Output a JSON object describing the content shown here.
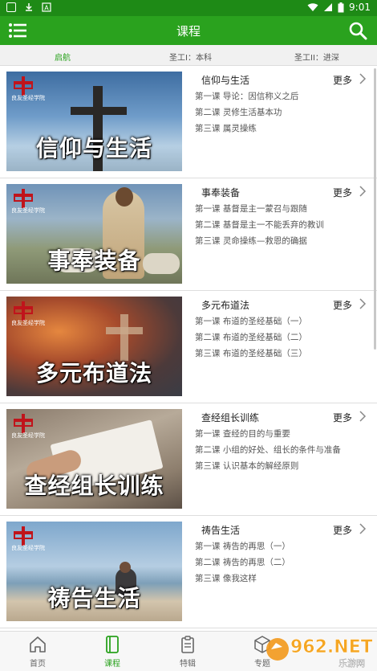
{
  "status": {
    "time": "9:01"
  },
  "appbar": {
    "title": "课程"
  },
  "tabs": [
    {
      "label": "启航"
    },
    {
      "label": "圣工I：本科"
    },
    {
      "label": "圣工II：进深"
    }
  ],
  "logo_text": "良友圣经学院",
  "more_label": "更多",
  "courses": [
    {
      "title": "信仰与生活",
      "image_title": "信仰与生活",
      "lessons": [
        "第一课 导论：因信称义之后",
        "第二课 灵修生活基本功",
        "第三课 属灵操练"
      ]
    },
    {
      "title": "事奉装备",
      "image_title": "事奉装备",
      "lessons": [
        "第一课 基督是主一蒙召与跟随",
        "第二课 基督是主一不能丢弃的教训",
        "第三课 灵命操练—救恩的确据"
      ]
    },
    {
      "title": "多元布道法",
      "image_title": "多元布道法",
      "lessons": [
        "第一课 布道的圣经基础（一）",
        "第二课 布道的圣经基础（二）",
        "第三课 布道的圣经基础（三）"
      ]
    },
    {
      "title": "查经组长训练",
      "image_title": "查经组长训练",
      "lessons": [
        "第一课 查经的目的与重要",
        "第二课 小组的好处、组长的条件与准备",
        "第三课 认识基本的解经原则"
      ]
    },
    {
      "title": "祷告生活",
      "image_title": "祷告生活",
      "lessons": [
        "第一课 祷告的再思（一）",
        "第二课 祷告的再思（二）",
        "第三课 像我这样"
      ]
    }
  ],
  "bottom_nav": [
    {
      "label": "首页"
    },
    {
      "label": "课程"
    },
    {
      "label": "特辑"
    },
    {
      "label": "专题"
    }
  ],
  "watermark": {
    "text": "962.NET",
    "sub": "乐游网"
  },
  "colors": {
    "primary": "#2aa21e",
    "status_bar": "#1e8a16",
    "logo_red": "#c0141b"
  }
}
